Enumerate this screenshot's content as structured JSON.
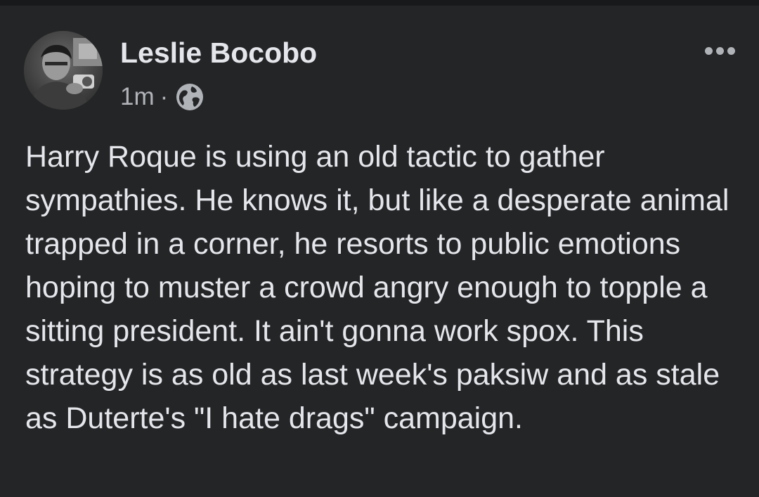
{
  "post": {
    "author": "Leslie Bocobo",
    "time": "1m",
    "separator": "·",
    "privacy_icon": "globe-icon",
    "menu_icon": "more-options-icon",
    "text": "Harry Roque is using an old tactic to gather sympathies. He knows it, but like a desperate animal trapped in a corner, he resorts to public emotions hoping to muster a crowd angry enough to topple a sitting president. It ain't gonna work spox. This strategy is as old as last week's paksiw and as stale as Duterte's \"I hate drags\" campaign."
  },
  "colors": {
    "background": "#242526",
    "primary_text": "#e4e6eb",
    "secondary_text": "#b0b3b8"
  }
}
